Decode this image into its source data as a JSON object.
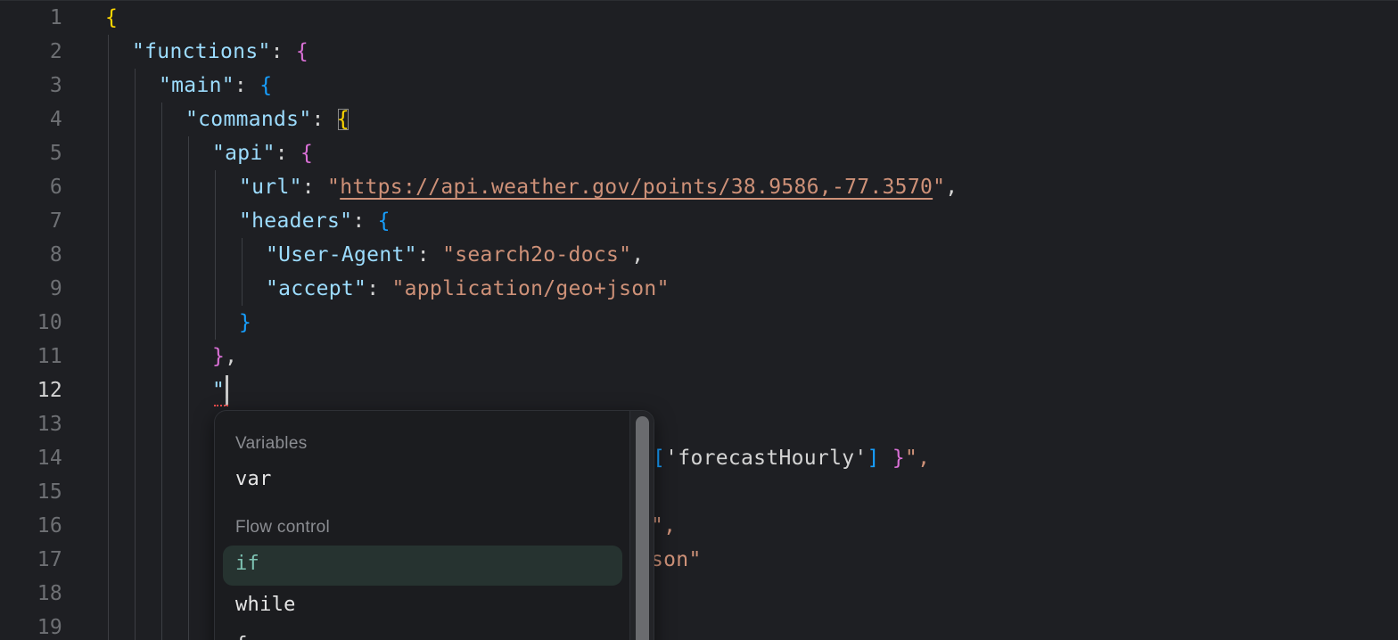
{
  "editor": {
    "line_numbers": [
      "1",
      "2",
      "3",
      "4",
      "5",
      "6",
      "7",
      "8",
      "9",
      "10",
      "11",
      "12",
      "13",
      "14",
      "15",
      "16",
      "17",
      "18",
      "19"
    ],
    "active_line": "12",
    "lines": {
      "l1_brace": "{",
      "l2_key": "\"functions\"",
      "l2_colon": ": ",
      "l2_brace": "{",
      "l3_key": "\"main\"",
      "l3_colon": ": ",
      "l3_brace": "{",
      "l4_key": "\"commands\"",
      "l4_colon": ": ",
      "l4_brace": "{",
      "l5_key": "\"api\"",
      "l5_colon": ": ",
      "l5_brace": "{",
      "l6_key": "\"url\"",
      "l6_colon": ": ",
      "l6_q1": "\"",
      "l6_url": "https://api.weather.gov/points/38.9586,-77.3570",
      "l6_q2": "\"",
      "l6_comma": ",",
      "l7_key": "\"headers\"",
      "l7_colon": ": ",
      "l7_brace": "{",
      "l8_key": "\"User-Agent\"",
      "l8_colon": ": ",
      "l8_val": "\"search2o-docs\"",
      "l8_comma": ",",
      "l9_key": "\"accept\"",
      "l9_colon": ": ",
      "l9_val": "\"application/geo+json\"",
      "l10_brace": "}",
      "l11_brace": "}",
      "l11_comma": ",",
      "l12_quote": "\"",
      "l14_bracket_open": "[",
      "l14_str": "'forecastHourly'",
      "l14_bracket_close": "]",
      "l14_space": " ",
      "l14_brace": "}",
      "l14_tail": "\",",
      "l16_tail": "\",",
      "l17_tail": "son\""
    }
  },
  "suggestions": {
    "groups": [
      {
        "header": "Variables",
        "items": [
          "var"
        ]
      },
      {
        "header": "Flow control",
        "items": [
          "if",
          "while",
          "f"
        ]
      }
    ],
    "selected": "if"
  }
}
